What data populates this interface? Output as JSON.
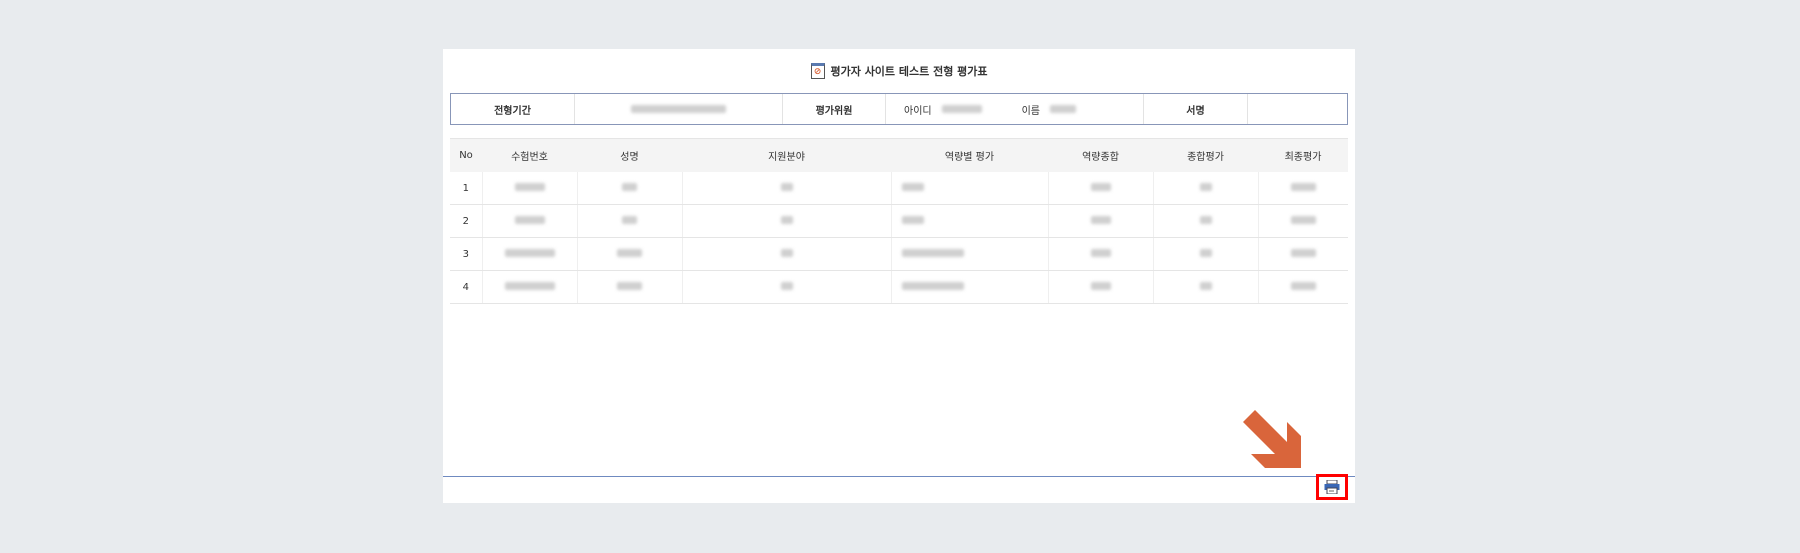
{
  "title": "평가자 사이트 테스트 전형 평가표",
  "info": {
    "period_label": "전형기간",
    "evaluator_label": "평가위원",
    "id_label": "아이디",
    "name_label": "이름",
    "signature_label": "서명"
  },
  "table": {
    "headers": [
      "No",
      "수험번호",
      "성명",
      "지원분야",
      "역량별 평가",
      "역량종합",
      "종합평가",
      "최종평가"
    ],
    "rows": [
      {
        "no": "1"
      },
      {
        "no": "2"
      },
      {
        "no": "3"
      },
      {
        "no": "4"
      }
    ]
  },
  "colors": {
    "accent": "#d9653b",
    "highlight": "#ff0000",
    "line": "#6f8ac0"
  }
}
